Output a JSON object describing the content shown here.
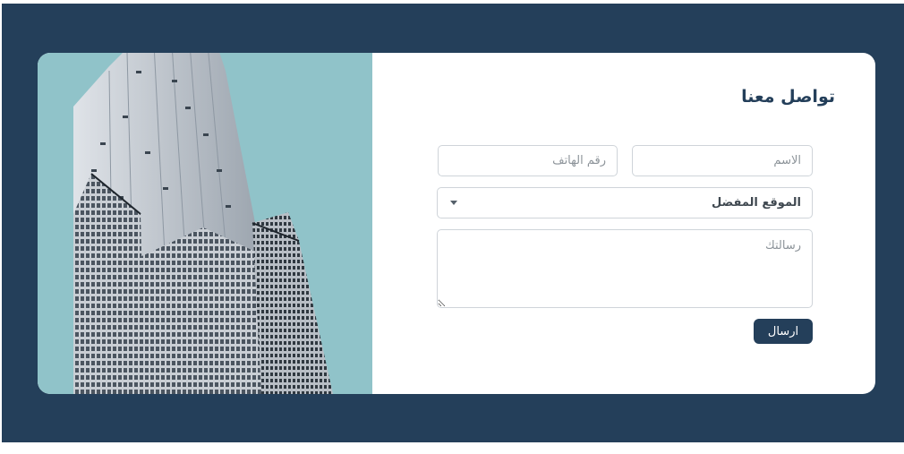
{
  "contact": {
    "title": "تواصل معنا",
    "name_placeholder": "الاسم",
    "phone_placeholder": "رقم الهاتف",
    "location_select": {
      "selected": "الموقع المفضل"
    },
    "message_placeholder": "رسالتك",
    "submit_label": "ارسال"
  },
  "colors": {
    "background": "#243f5a",
    "card": "#ffffff",
    "image_panel_bg": "#90c3c9",
    "button": "#243f5a"
  },
  "icons": {
    "select_caret": "caret-down-icon",
    "resize": "resize-handle-icon"
  }
}
